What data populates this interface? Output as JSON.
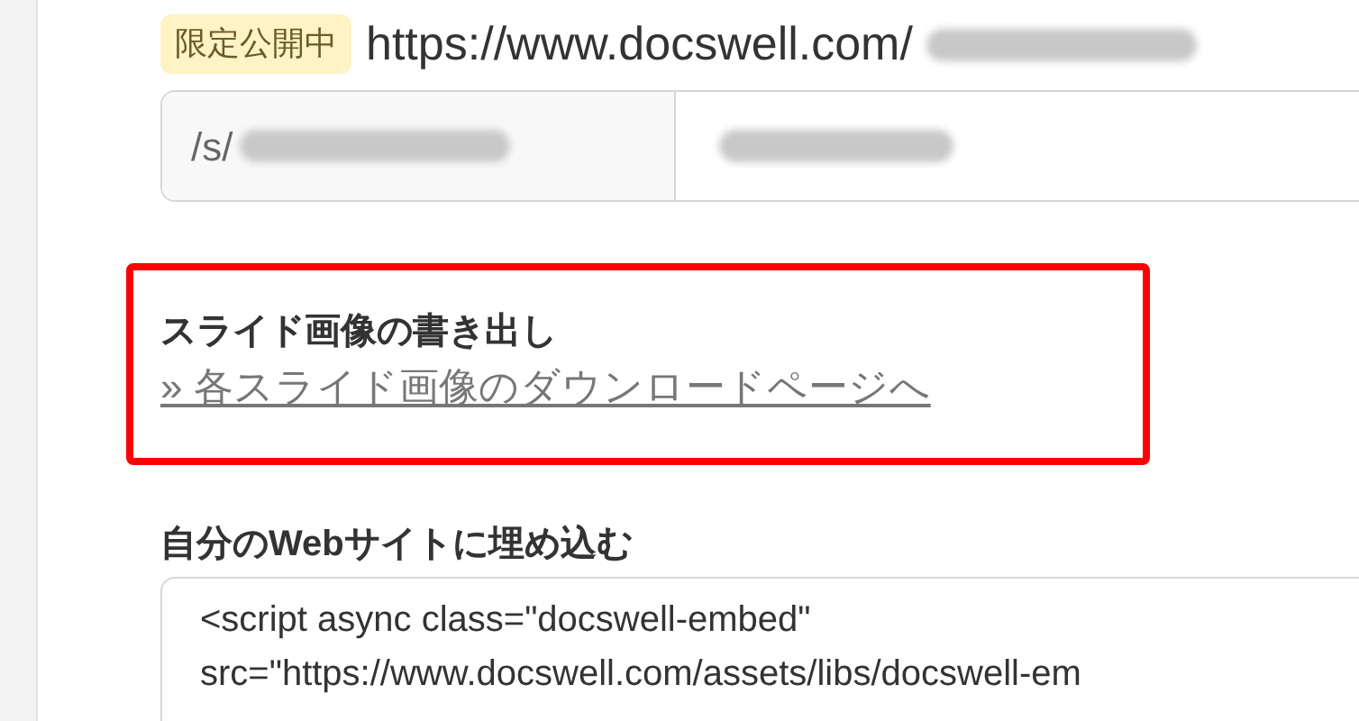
{
  "share": {
    "badge": "限定公開中",
    "url": "https://www.docswell.com/",
    "url_redacted": true,
    "path_prefix": "/s/",
    "path_redacted": true,
    "value_redacted": true
  },
  "export": {
    "title": "スライド画像の書き出し",
    "link": "» 各スライド画像のダウンロードページへ",
    "highlighted": true
  },
  "embed": {
    "title": "自分のWebサイトに埋め込む",
    "code_lines": [
      "<script async class=\"docswell-embed\"",
      "src=\"https://www.docswell.com/assets/libs/docswell-em"
    ]
  }
}
